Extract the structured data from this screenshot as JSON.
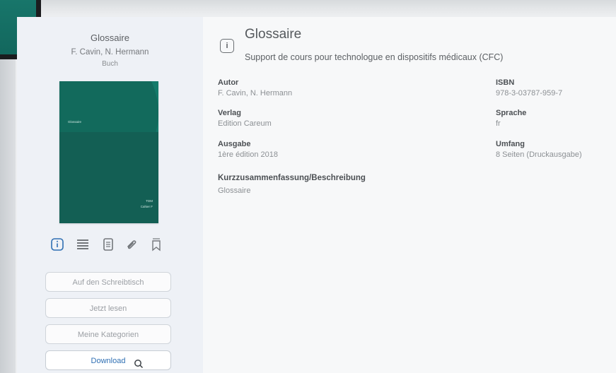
{
  "sidebar": {
    "title": "Glossaire",
    "author": "F. Cavin, N. Hermann",
    "type": "Buch",
    "cover": {
      "title": "Glossaire",
      "code": "TDM",
      "subtitle": "Cahier F"
    },
    "icons": [
      {
        "name": "info-icon"
      },
      {
        "name": "list-icon"
      },
      {
        "name": "document-icon"
      },
      {
        "name": "paperclip-icon"
      },
      {
        "name": "bookmark-icon"
      }
    ],
    "buttons": [
      {
        "label": "Auf den Schreibtisch"
      },
      {
        "label": "Jetzt lesen"
      },
      {
        "label": "Meine Kategorien"
      },
      {
        "label": "Download"
      }
    ]
  },
  "main": {
    "title": "Glossaire",
    "subtitle": "Support de cours pour technologue en dispositifs médicaux (CFC)",
    "fields": {
      "autor": {
        "label": "Autor",
        "value": "F. Cavin, N. Hermann"
      },
      "isbn": {
        "label": "ISBN",
        "value": "978-3-03787-959-7"
      },
      "verlag": {
        "label": "Verlag",
        "value": "Edition Careum"
      },
      "sprache": {
        "label": "Sprache",
        "value": "fr"
      },
      "ausgabe": {
        "label": "Ausgabe",
        "value": "1ère édition 2018"
      },
      "umfang": {
        "label": "Umfang",
        "value": "8 Seiten (Druckausgabe)"
      }
    },
    "description": {
      "label": "Kurzzusammenfassung/Beschreibung",
      "value": "Glossaire"
    }
  },
  "colors": {
    "accent": "#2f6fb3",
    "cover": "#167566",
    "sidebar": "#eef1f6"
  }
}
